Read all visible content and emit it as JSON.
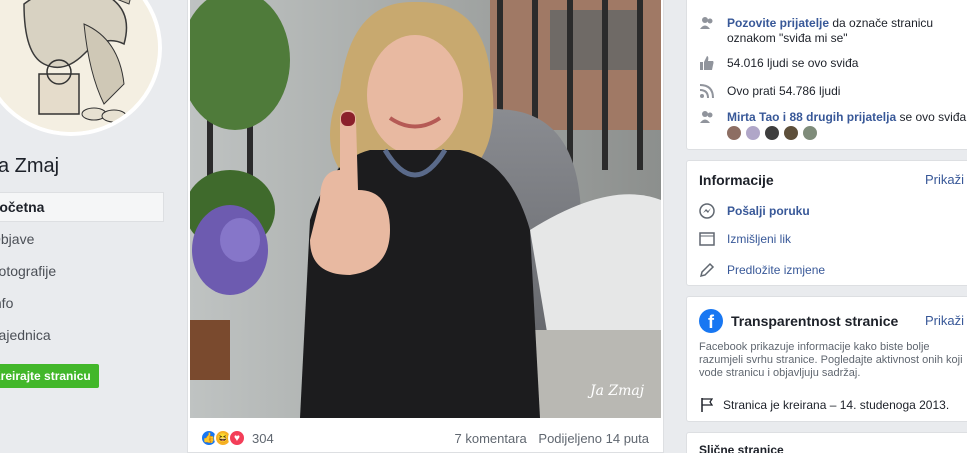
{
  "left": {
    "page_name": "Ja Zmaj",
    "nav": [
      "Početna",
      "Objave",
      "Fotografije",
      "Info",
      "Zajednica"
    ],
    "create_page": "Kreirajte stranicu"
  },
  "post": {
    "watermark": "Ja Zmaj",
    "reactions_count": "304",
    "comments": "7 komentara",
    "shares": "Podijeljeno 14 puta"
  },
  "community": {
    "invite_link": "Pozovite prijatelje",
    "invite_rest": " da označe stranicu",
    "invite_line2": "oznakom \"sviđa mi se\"",
    "likes": "54.016 ljudi se ovo sviđa",
    "follows": "Ovo prati 54.786 ljudi",
    "friends_link": "Mirta Tao i 88 drugih prijatelja",
    "friends_rest": " se ovo sviđa."
  },
  "info": {
    "title": "Informacije",
    "more": "Prikaži sve",
    "message": "Pošalji poruku",
    "category": "Izmišljeni lik",
    "suggest": "Predložite izmjene"
  },
  "transparency": {
    "title": "Transparentnost stranice",
    "more": "Prikaži više",
    "desc": "Facebook prikazuje informacije kako biste bolje razumjeli svrhu stranice. Pogledajte aktivnost onih koji vode stranicu i objavljuju sadržaj.",
    "created": "Stranica je kreirana – 14. studenoga 2013."
  },
  "similar": {
    "title": "Slične stranice"
  },
  "colors": {
    "accent": "#385898",
    "green": "#42b72a",
    "like": "#1877f2",
    "love": "#f33e58",
    "haha": "#f7b125"
  }
}
